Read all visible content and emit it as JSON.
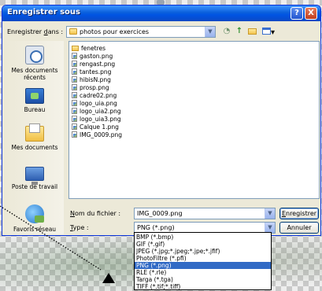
{
  "dialog": {
    "title": "Enregistrer sous",
    "help_label": "?",
    "close_label": "X"
  },
  "save_in": {
    "label_underline": "d",
    "label_pre": "Enregistrer ",
    "label_post": "ans :",
    "folder": "photos pour exercices"
  },
  "places": [
    {
      "label": "Mes documents récents",
      "icon": "recent-documents-icon"
    },
    {
      "label": "Bureau",
      "icon": "desktop-icon"
    },
    {
      "label": "Mes documents",
      "icon": "my-documents-icon"
    },
    {
      "label": "Poste de travail",
      "icon": "my-computer-icon"
    },
    {
      "label": "Favoris réseau",
      "icon": "network-places-icon"
    }
  ],
  "files": [
    {
      "name": "fenetres",
      "type": "folder"
    },
    {
      "name": "gaston.png",
      "type": "file"
    },
    {
      "name": "rengast.png",
      "type": "file"
    },
    {
      "name": "tantes.png",
      "type": "file"
    },
    {
      "name": "hibisN.png",
      "type": "file"
    },
    {
      "name": "prosp.png",
      "type": "file"
    },
    {
      "name": "cadre02.png",
      "type": "file"
    },
    {
      "name": "logo_uia.png",
      "type": "file"
    },
    {
      "name": "logo_uia2.png",
      "type": "file"
    },
    {
      "name": "logo_uia3.png",
      "type": "file"
    },
    {
      "name": "Calque 1.png",
      "type": "file"
    },
    {
      "name": "IMG_0009.png",
      "type": "file"
    }
  ],
  "filename": {
    "label_underline": "N",
    "label_rest": "om du fichier :",
    "value": "IMG_0009.png"
  },
  "filetype": {
    "label_underline": "T",
    "label_rest": "ype :",
    "value": "PNG (*.png)",
    "options": [
      "BMP (*.bmp)",
      "GIF (*.gif)",
      "JPEG (*.jpg;*.jpeg;*.jpe;*.jfif)",
      "PhotoFiltre (*.pfi)",
      "PNG (*.png)",
      "RLE (*.rle)",
      "Targa (*.tga)",
      "TIFF (*.tif;*.tiff)"
    ],
    "selected_index": 4
  },
  "buttons": {
    "save_underline": "E",
    "save_rest": "nregistrer",
    "cancel": "Annuler"
  },
  "colors": {
    "titlebar": "#0054e3",
    "selection": "#316ac5",
    "dialog_bg": "#ece9d8"
  }
}
